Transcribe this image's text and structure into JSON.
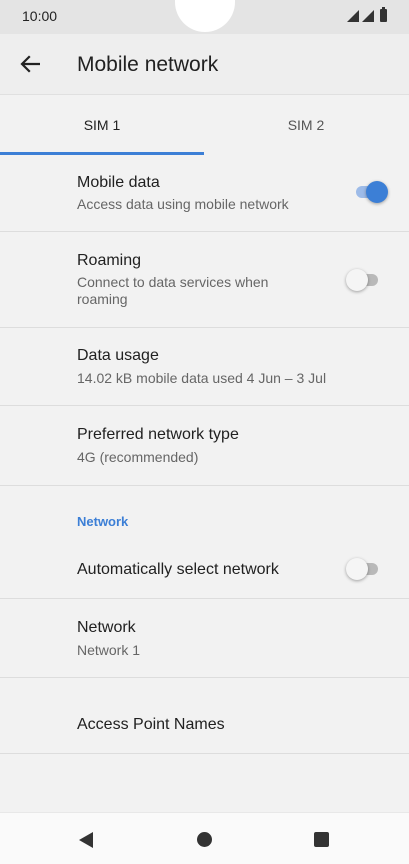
{
  "status_bar": {
    "time": "10:00"
  },
  "app_bar": {
    "title": "Mobile network"
  },
  "tabs": [
    {
      "label": "SIM 1",
      "active": true
    },
    {
      "label": "SIM 2",
      "active": false
    }
  ],
  "settings": {
    "mobile_data": {
      "title": "Mobile data",
      "subtitle": "Access data using mobile network",
      "enabled": true
    },
    "roaming": {
      "title": "Roaming",
      "subtitle": "Connect to data services when roaming",
      "enabled": false
    },
    "data_usage": {
      "title": "Data usage",
      "subtitle": "14.02 kB mobile data used 4 Jun – 3 Jul"
    },
    "preferred_network_type": {
      "title": "Preferred network type",
      "subtitle": "4G (recommended)"
    },
    "network_section": {
      "header": "Network"
    },
    "auto_select_network": {
      "title": "Automatically select network",
      "enabled": false
    },
    "network": {
      "title": "Network",
      "subtitle": "Network 1"
    },
    "apn": {
      "title": "Access Point Names"
    }
  },
  "colors": {
    "accent": "#3c7fd6",
    "background": "#f2f2f2"
  },
  "icons": {
    "back": "arrow-left-icon",
    "nav_back": "triangle-back-icon",
    "nav_home": "circle-home-icon",
    "nav_recents": "square-recents-icon"
  }
}
